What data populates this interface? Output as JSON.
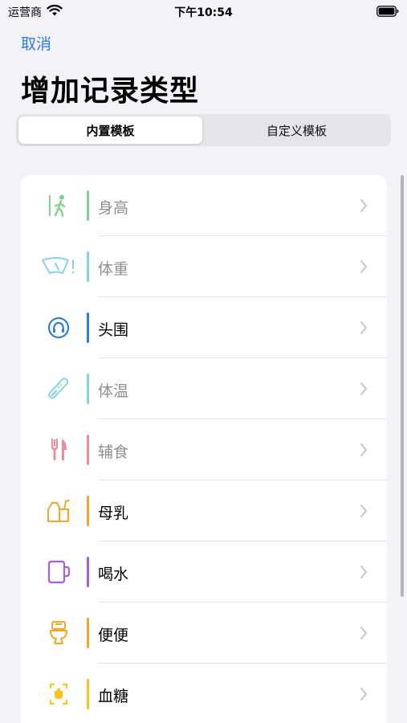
{
  "status_bar": {
    "carrier": "运营商",
    "time": "下午10:54"
  },
  "nav": {
    "cancel_label": "取消"
  },
  "title": "增加记录类型",
  "segments": {
    "builtin_label": "内置模板",
    "custom_label": "自定义模板",
    "selected": "内置模板"
  },
  "colors": {
    "accent_blue": "#2b7de9",
    "height_green": "#7fd38f",
    "weight_cyan": "#82d4ec",
    "head_blue": "#2f80d9",
    "temp_teal": "#7fd8e0",
    "food_pink": "#f08aa0",
    "milk_orange": "#f5a623",
    "water_purple": "#a95fd8",
    "stool_orange": "#f5a623",
    "glucose_yellow": "#f8c51c"
  },
  "items": [
    {
      "label": "身高",
      "icon": "walking-person-height-icon",
      "enabled": false
    },
    {
      "label": "体重",
      "icon": "scale-weight-icon",
      "enabled": false
    },
    {
      "label": "头围",
      "icon": "head-circumference-icon",
      "enabled": true
    },
    {
      "label": "体温",
      "icon": "thermometer-icon",
      "enabled": false
    },
    {
      "label": "辅食",
      "icon": "fork-knife-icon",
      "enabled": false
    },
    {
      "label": "母乳",
      "icon": "breast-milk-icon",
      "enabled": true
    },
    {
      "label": "喝水",
      "icon": "cup-icon",
      "enabled": true
    },
    {
      "label": "便便",
      "icon": "toilet-icon",
      "enabled": true
    },
    {
      "label": "血糖",
      "icon": "blood-glucose-icon",
      "enabled": true
    }
  ]
}
